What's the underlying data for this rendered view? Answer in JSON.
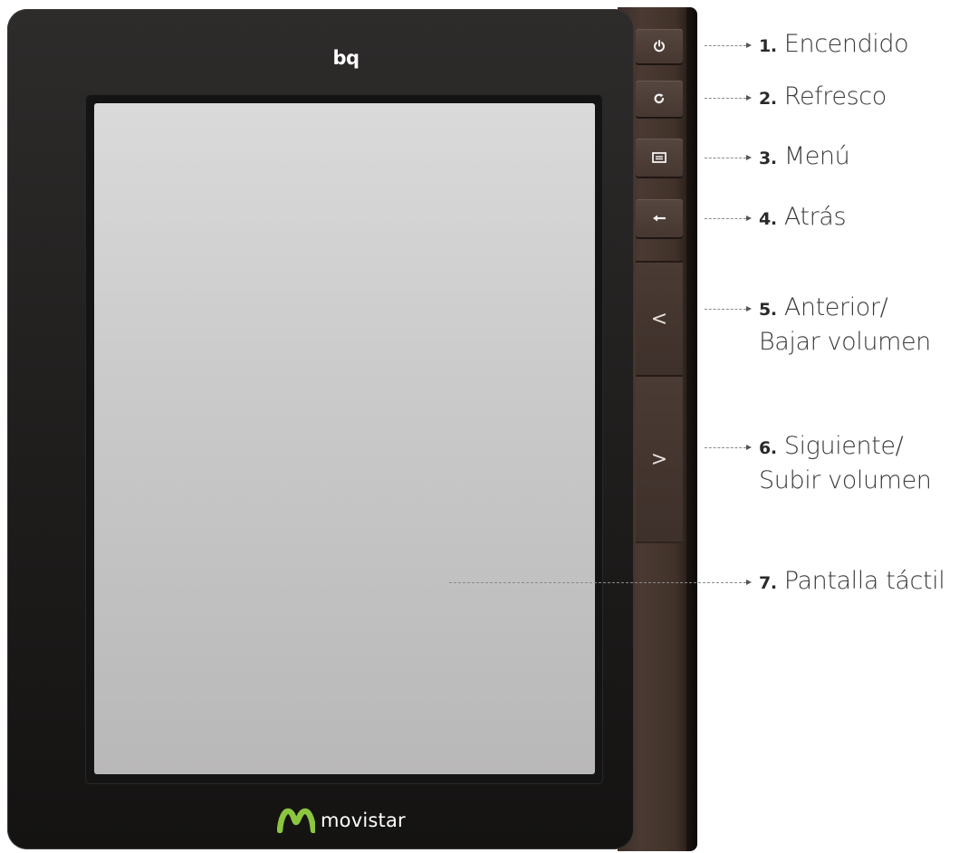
{
  "device": {
    "brand": "bq",
    "operator": "movistar"
  },
  "buttons": [
    {
      "icon": "power-icon",
      "symbol": "⏻"
    },
    {
      "icon": "refresh-icon",
      "symbol": "↻"
    },
    {
      "icon": "menu-icon",
      "symbol": "▤"
    },
    {
      "icon": "back-arrow-icon",
      "symbol": "←"
    }
  ],
  "nav": {
    "prev_symbol": "<",
    "next_symbol": ">"
  },
  "callouts": [
    {
      "num": "1.",
      "text": "Encendido"
    },
    {
      "num": "2.",
      "text": "Refresco"
    },
    {
      "num": "3.",
      "text": "Menú"
    },
    {
      "num": "4.",
      "text": "Atrás"
    },
    {
      "num": "5.",
      "text": "Anterior/",
      "text2": "Bajar volumen"
    },
    {
      "num": "6.",
      "text": "Siguiente/",
      "text2": "Subir volumen"
    },
    {
      "num": "7.",
      "text": "Pantalla táctil"
    }
  ],
  "colors": {
    "body": "#1f1d1c",
    "side": "#4a3a33",
    "screen": "#c9c9c9",
    "logo_green": "#8cc63f"
  }
}
